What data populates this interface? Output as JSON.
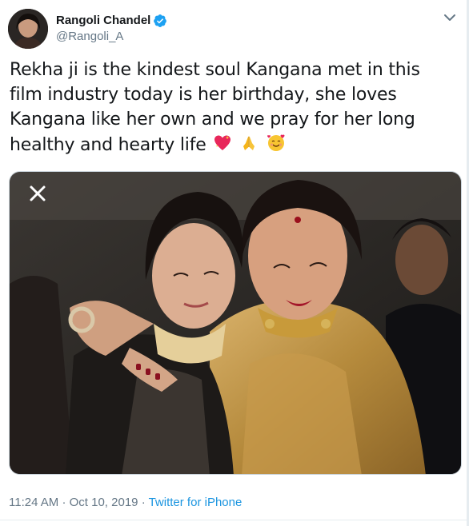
{
  "author": {
    "display_name": "Rangoli Chandel",
    "handle": "@Rangoli_A",
    "verified": true
  },
  "tweet": {
    "text": "Rekha ji is the kindest soul Kangana met in this film industry today is her birthday, she loves Kangana like her own and we pray for her long healthy and hearty life",
    "emojis": [
      "sparkling-heart",
      "folded-hands",
      "smiling-face-with-hearts"
    ]
  },
  "media": {
    "close_icon": "close-icon"
  },
  "meta": {
    "time": "11:24 AM",
    "separator": "·",
    "date": "Oct 10, 2019",
    "source": "Twitter for iPhone"
  },
  "colors": {
    "link": "#1b95e0",
    "verified": "#1da1f2",
    "secondary_text": "#657786"
  }
}
